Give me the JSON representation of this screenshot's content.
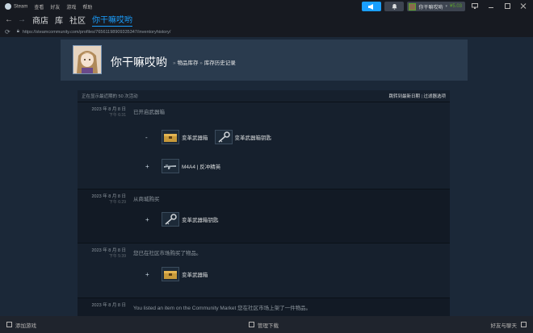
{
  "titlebar": {
    "app_name": "Steam",
    "menus": [
      "查看",
      "好友",
      "游戏",
      "帮助"
    ],
    "announce_icon": "megaphone-icon",
    "notify_icon": "bell-icon",
    "username": "你干嘛哎哟",
    "wallet": "¥5.03",
    "window_controls": [
      "monitor-icon",
      "minimize-icon",
      "maximize-icon",
      "close-icon"
    ]
  },
  "nav": {
    "items": [
      "商店",
      "库",
      "社区",
      "你干嘛哎哟"
    ],
    "active_index": 3
  },
  "url": {
    "text": "https://steamcommunity.com/profiles/76561198909335347/inventoryhistory/"
  },
  "profile": {
    "name": "你干嘛哎哟",
    "separator": "»",
    "crumb_inventory": "物品库存",
    "crumb_history": "库存历史记录"
  },
  "history": {
    "showing_text": "正在显示最近期的 50 次活动",
    "jump_text": "跳转到最新日期",
    "filter_text": "过滤器选项",
    "entries": [
      {
        "date": "2023 年 8 月 8 日",
        "time": "下午 6:31",
        "description": "已开启武器箱",
        "lines": [
          {
            "sign": "-",
            "items": [
              {
                "name": "变革武器箱",
                "icon": "crate-icon"
              },
              {
                "name": "变革武器箱钥匙",
                "icon": "key-icon"
              }
            ]
          },
          {
            "sign": "+",
            "items": [
              {
                "name": "M4A4 | 反冲精英",
                "icon": "rifle-icon"
              }
            ]
          }
        ]
      },
      {
        "date": "2023 年 8 月 8 日",
        "time": "下午 6:29",
        "description": "从商城购买",
        "lines": [
          {
            "sign": "+",
            "items": [
              {
                "name": "变革武器箱钥匙",
                "icon": "key-icon"
              }
            ]
          }
        ]
      },
      {
        "date": "2023 年 8 月 8 日",
        "time": "下午 5:39",
        "description": "您已在社区市场购买了物品。",
        "lines": [
          {
            "sign": "+",
            "items": [
              {
                "name": "变革武器箱",
                "icon": "crate-icon"
              }
            ]
          }
        ]
      },
      {
        "date": "2023 年 8 月 8 日",
        "time": "",
        "description": "You listed an item on the Community Market 您在社区市场上架了一件物品。",
        "lines": []
      }
    ]
  },
  "bottombar": {
    "add_game": "添加游戏",
    "manage_downloads": "管理下载",
    "friends_chat": "好友与聊天"
  },
  "colors": {
    "accent": "#1a9fff",
    "wallet": "#5ba32b",
    "background": "#1b2838"
  }
}
